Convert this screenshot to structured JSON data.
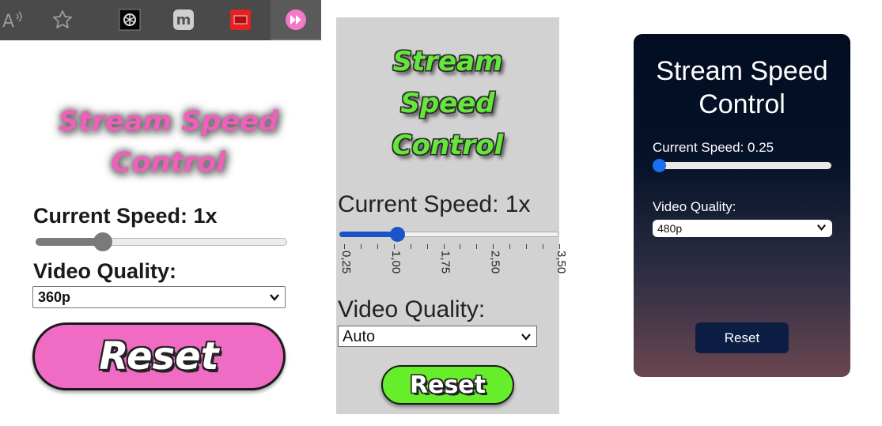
{
  "toolbar": {
    "icons": [
      "read-aloud-icon",
      "favorite-star-icon",
      "extension-cube-icon",
      "extension-m-icon",
      "extension-screen-icon",
      "stream-speed-extension-icon"
    ],
    "read_aloud_glyph": "A",
    "ext_m_glyph": "m"
  },
  "panel_pink": {
    "title": "Stream Speed Control",
    "speed_label": "Current Speed: 1x",
    "slider": {
      "min": 0.25,
      "max": 3.5,
      "value": 1
    },
    "quality_label": "Video Quality:",
    "quality_selected": "360p",
    "reset_label": "Reset",
    "colors": {
      "accent": "#ef6bc4",
      "slider": "#7a7a7a"
    }
  },
  "panel_grey": {
    "title": "Stream Speed Control",
    "speed_label": "Current Speed: 1x",
    "slider": {
      "min": 0.25,
      "max": 3.5,
      "value": 1
    },
    "tick_labels": [
      "0,25",
      "1,00",
      "1,75",
      "2,50",
      "3,50"
    ],
    "quality_label": "Video Quality:",
    "quality_selected": "Auto",
    "reset_label": "Reset",
    "colors": {
      "accent": "#66ee2a",
      "slider": "#1a55c8"
    }
  },
  "panel_dark": {
    "title": "Stream Speed Control",
    "speed_label": "Current Speed: 0.25",
    "slider": {
      "min": 0.25,
      "max": 3.5,
      "value": 0.25
    },
    "quality_label": "Video Quality:",
    "quality_selected": "480p",
    "reset_label": "Reset",
    "colors": {
      "background_top": "#020d22",
      "background_bottom": "#6a4650",
      "slider": "#1a6ef0",
      "button": "#0c1e44"
    }
  }
}
